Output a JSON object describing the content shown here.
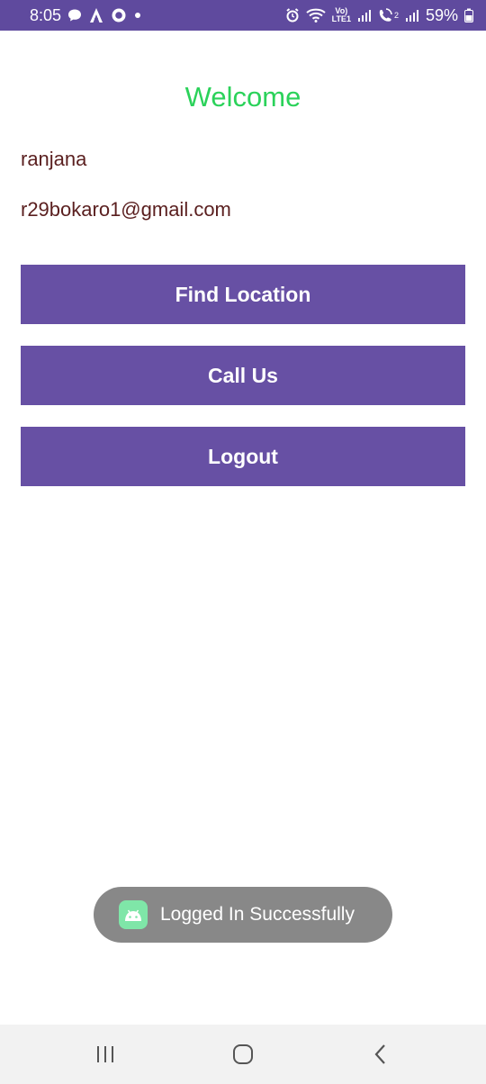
{
  "status_bar": {
    "time": "8:05",
    "battery_percent": "59%",
    "network_label_top": "Vo)",
    "network_label_bottom": "LTE1",
    "sim2_label": "2",
    "left_icons": [
      "message-icon",
      "a-app-icon",
      "circle-app-icon",
      "dot-icon"
    ],
    "right_icons": [
      "alarm-icon",
      "wifi-icon",
      "volte-icon",
      "signal-icon",
      "wifi-calling-icon",
      "signal-icon",
      "battery-icon"
    ],
    "background_color": "#5f4a9e"
  },
  "main": {
    "welcome_text": "Welcome",
    "welcome_color": "#2bd25a",
    "user_name": "ranjana",
    "user_email": "r29bokaro1@gmail.com",
    "text_color": "#5a1f1f"
  },
  "buttons": {
    "find_location": "Find Location",
    "call_us": "Call Us",
    "logout": "Logout",
    "color": "#6750a4"
  },
  "toast": {
    "message": "Logged In Successfully",
    "icon": "android-icon"
  },
  "nav_bar": {
    "items": [
      "recent-apps-icon",
      "home-icon",
      "back-icon"
    ]
  }
}
